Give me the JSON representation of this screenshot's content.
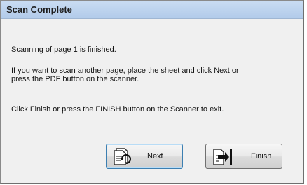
{
  "dialog": {
    "title": "Scan Complete",
    "message_line1": "Scanning of page 1 is finished.",
    "message_line2": "If you want to scan another page, place the sheet and click Next or\npress the PDF button on the scanner.",
    "message_line3": "Click Finish or press the FINISH button on the Scanner to exit."
  },
  "buttons": {
    "next": {
      "label": "Next",
      "icon": "scan-next-icon"
    },
    "finish": {
      "label": "Finish",
      "icon": "finish-exit-icon"
    }
  }
}
